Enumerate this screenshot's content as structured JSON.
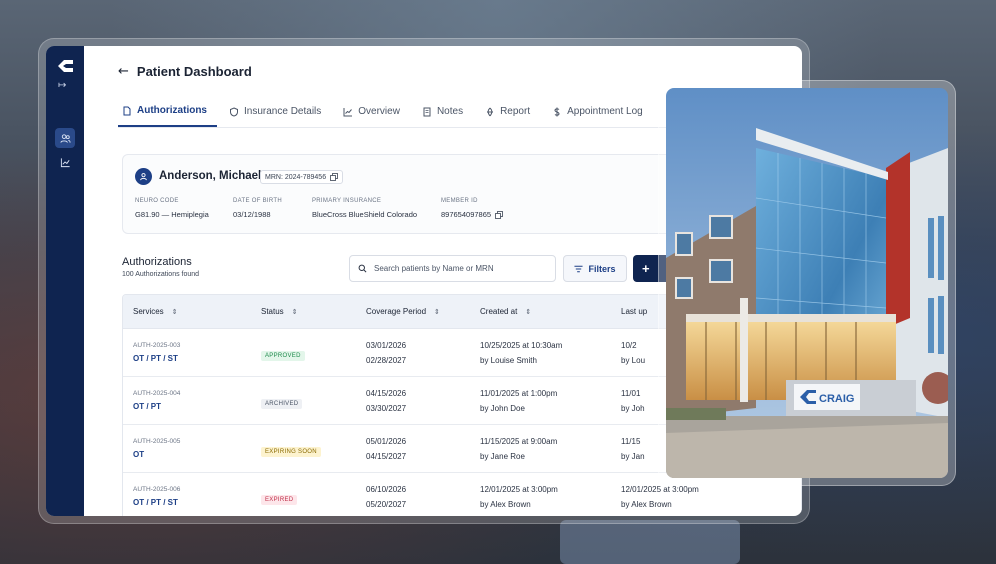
{
  "header": {
    "back_icon": "arrow-left-icon",
    "title": "Patient Dashboard"
  },
  "rail": {
    "expand_symbol": "↦",
    "items": [
      "users-icon",
      "chart-icon"
    ]
  },
  "tabs": [
    {
      "label": "Authorizations",
      "icon": "file-icon",
      "active": true
    },
    {
      "label": "Insurance Details",
      "icon": "shield-icon",
      "active": false
    },
    {
      "label": "Overview",
      "icon": "line-chart-icon",
      "active": false
    },
    {
      "label": "Notes",
      "icon": "notes-icon",
      "active": false
    },
    {
      "label": "Report",
      "icon": "report-icon",
      "active": false
    },
    {
      "label": "Appointment Log",
      "icon": "dollar-icon",
      "active": false
    }
  ],
  "patient": {
    "name": "Anderson, Michael",
    "mrn": "MRN: 2024-789456",
    "fields": [
      {
        "label": "NEURO CODE",
        "value": "G81.90 — Hemiplegia"
      },
      {
        "label": "DATE OF BIRTH",
        "value": "03/12/1988"
      },
      {
        "label": "PRIMARY INSURANCE",
        "value": "BlueCross BlueShield Colorado"
      },
      {
        "label": "MEMBER ID",
        "value": "897654097865"
      }
    ]
  },
  "authorizations": {
    "title": "Authorizations",
    "count_text": "100 Authorizations found",
    "search_placeholder": "Search patients by Name or MRN",
    "filters_label": "Filters",
    "add_symbol": "+"
  },
  "table": {
    "columns": [
      "Services",
      "Status",
      "Coverage Period",
      "Created at",
      "Last up"
    ],
    "rows": [
      {
        "id": "AUTH-2025-003",
        "services": "OT / PT / ST",
        "status": "APPROVED",
        "coverage_start": "03/01/2026",
        "coverage_end": "02/28/2027",
        "created_at": "10/25/2025 at 10:30am",
        "created_by": "by Louise Smith",
        "last_line1": "10/2",
        "last_line2": "by Lou"
      },
      {
        "id": "AUTH-2025-004",
        "services": "OT / PT",
        "status": "ARCHIVED",
        "coverage_start": "04/15/2026",
        "coverage_end": "03/30/2027",
        "created_at": "11/01/2025 at 1:00pm",
        "created_by": "by John Doe",
        "last_line1": "11/01",
        "last_line2": "by Joh"
      },
      {
        "id": "AUTH-2025-005",
        "services": "OT",
        "status": "EXPIRING SOON",
        "coverage_start": "05/01/2026",
        "coverage_end": "04/15/2027",
        "created_at": "11/15/2025 at 9:00am",
        "created_by": "by Jane Roe",
        "last_line1": "11/15",
        "last_line2": "by Jan"
      },
      {
        "id": "AUTH-2025-006",
        "services": "OT / PT / ST",
        "status": "EXPIRED",
        "coverage_start": "06/10/2026",
        "coverage_end": "05/20/2027",
        "created_at": "12/01/2025 at 3:00pm",
        "created_by": "by Alex Brown",
        "last_line1": "12/01/2025 at 3:00pm",
        "last_line2": "by Alex Brown"
      }
    ]
  },
  "status_colors": {
    "APPROVED": {
      "bg": "#e3f6ea",
      "fg": "#1f8a4c"
    },
    "ARCHIVED": {
      "bg": "#eef0f4",
      "fg": "#4b5566"
    },
    "EXPIRING SOON": {
      "bg": "#fdf3cf",
      "fg": "#8a6a00"
    },
    "EXPIRED": {
      "bg": "#fde6ea",
      "fg": "#c0304a"
    }
  },
  "photo": {
    "sign_text": "CRAIG"
  },
  "colors": {
    "brand_navy": "#0f2450",
    "accent_blue": "#1d3f86"
  }
}
